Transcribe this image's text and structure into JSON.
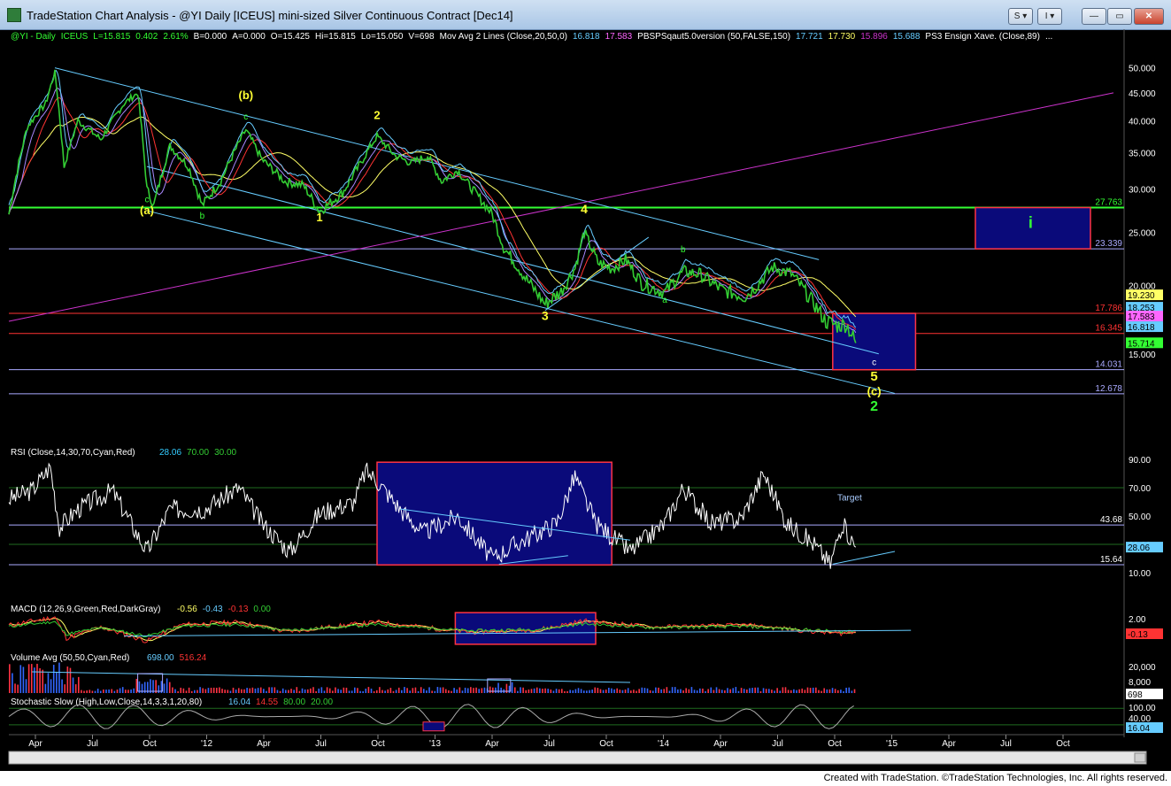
{
  "window": {
    "title": "TradeStation Chart Analysis - @YI Daily [ICEUS] mini-sized Silver Continuous Contract [Dec14]",
    "btn_s": "S ▾",
    "btn_grip": "I ▾",
    "btn_min": "—",
    "btn_max": "▭",
    "btn_close": "✕"
  },
  "footer": {
    "credit": "Created with TradeStation. ©TradeStation Technologies, Inc. All rights reserved."
  },
  "colors": {
    "background": "#000000",
    "price": "#33cc33",
    "rsi": "#ffffff",
    "channel": "#66ccff",
    "magenta": "#cc33cc",
    "box": "#0a0a7a",
    "wave": "#ffff33"
  },
  "chart_data": [
    {
      "type": "line",
      "header": [
        {
          "text": "@YI - Daily",
          "color": "#33ff33"
        },
        {
          "text": "ICEUS",
          "color": "#33ff33"
        },
        {
          "text": "L=15.815",
          "color": "#33ff33"
        },
        {
          "text": "0.402",
          "color": "#33ff33"
        },
        {
          "text": "2.61%",
          "color": "#33ff33"
        },
        {
          "text": "B=0.000",
          "color": "#ffffff"
        },
        {
          "text": "A=0.000",
          "color": "#ffffff"
        },
        {
          "text": "O=15.425",
          "color": "#ffffff"
        },
        {
          "text": "Hi=15.815",
          "color": "#ffffff"
        },
        {
          "text": "Lo=15.050",
          "color": "#ffffff"
        },
        {
          "text": "V=698",
          "color": "#ffffff"
        },
        {
          "text": "Mov Avg 2 Lines (Close,20,50,0)",
          "color": "#ffffff"
        },
        {
          "text": "16.818",
          "color": "#66ccff"
        },
        {
          "text": "17.583",
          "color": "#ff66ff"
        },
        {
          "text": "PBSPSqaut5.0version (50,FALSE,150)",
          "color": "#ffffff"
        },
        {
          "text": "17.721",
          "color": "#66ccff"
        },
        {
          "text": "17.730",
          "color": "#ffff66"
        },
        {
          "text": "15.896",
          "color": "#cc33cc"
        },
        {
          "text": "15.688",
          "color": "#66ccff"
        },
        {
          "text": "PS3 Ensign Xave. (Close,89)",
          "color": "#ffffff"
        },
        {
          "text": "...",
          "color": "#ffffff"
        }
      ],
      "y_ticks": [
        "50.000",
        "45.000",
        "40.000",
        "35.000",
        "30.000",
        "25.000",
        "20.000",
        "15.000"
      ],
      "x_ticks": [
        "Apr",
        "Jul",
        "Oct",
        "'12",
        "Apr",
        "Jul",
        "Oct",
        "'13",
        "Apr",
        "Jul",
        "Oct",
        "'14",
        "Apr",
        "Jul",
        "Oct",
        "'15",
        "Apr",
        "Jul",
        "Oct"
      ],
      "levels": [
        {
          "label": "27.763",
          "value": 27.763,
          "color": "#33ff33"
        },
        {
          "label": "23.339",
          "value": 23.339,
          "color": "#aaaaff"
        },
        {
          "label": "17.786",
          "value": 17.786,
          "color": "#ff3333"
        },
        {
          "label": "16.345",
          "value": 16.345,
          "color": "#ff3333"
        },
        {
          "label": "14.031",
          "value": 14.031,
          "color": "#aaaaff"
        },
        {
          "label": "12.678",
          "value": 12.678,
          "color": "#aaaaff"
        }
      ],
      "last_value_tags": [
        {
          "label": "19.230",
          "value": 19.23,
          "bg": "#ffff66",
          "fg": "#000000"
        },
        {
          "label": "18.253",
          "value": 18.253,
          "bg": "#66ccff",
          "fg": "#000000"
        },
        {
          "label": "17.583",
          "value": 17.583,
          "bg": "#ff66ff",
          "fg": "#000000"
        },
        {
          "label": "16.818",
          "value": 16.818,
          "bg": "#66ccff",
          "fg": "#000000"
        },
        {
          "label": "15.714",
          "value": 15.714,
          "bg": "#33ff33",
          "fg": "#000000"
        }
      ],
      "wave_labels": [
        {
          "text": "(a)",
          "color": "#ffff33",
          "x": 0.06,
          "y": 27.0,
          "size": 13
        },
        {
          "text": "c",
          "color": "#33ff33",
          "x": 0.06,
          "y": 28.4,
          "size": 10
        },
        {
          "text": "b",
          "color": "#33ff33",
          "x": 0.084,
          "y": 26.5,
          "size": 10
        },
        {
          "text": "(b)",
          "color": "#ffff33",
          "x": 0.103,
          "y": 43.8,
          "size": 13
        },
        {
          "text": "c",
          "color": "#33ff33",
          "x": 0.103,
          "y": 40.2,
          "size": 10
        },
        {
          "text": "1",
          "color": "#ffff33",
          "x": 0.135,
          "y": 26.2,
          "size": 13
        },
        {
          "text": "2",
          "color": "#ffff33",
          "x": 0.16,
          "y": 40.3,
          "size": 13
        },
        {
          "text": "3",
          "color": "#ffff33",
          "x": 0.233,
          "y": 17.3,
          "size": 14
        },
        {
          "text": "4",
          "color": "#ffff33",
          "x": 0.25,
          "y": 27.1,
          "size": 14
        },
        {
          "text": "a",
          "color": "#33ff33",
          "x": 0.285,
          "y": 18.6,
          "size": 10
        },
        {
          "text": "b",
          "color": "#33ff33",
          "x": 0.293,
          "y": 23.0,
          "size": 10
        },
        {
          "text": "c",
          "color": "#ffffff",
          "x": 0.376,
          "y": 14.3,
          "size": 10
        },
        {
          "text": "5",
          "color": "#ffff33",
          "x": 0.376,
          "y": 13.4,
          "size": 15
        },
        {
          "text": "(c)",
          "color": "#ffff33",
          "x": 0.376,
          "y": 12.6,
          "size": 13
        },
        {
          "text": "2",
          "color": "#33ff33",
          "x": 0.376,
          "y": 11.8,
          "size": 16
        },
        {
          "text": "i",
          "color": "#33ff33",
          "x": 0.444,
          "y": 25.5,
          "size": 18
        }
      ],
      "boxes": [
        {
          "x0": 0.358,
          "x1": 0.394,
          "y0": 17.786,
          "y1": 14.031
        },
        {
          "x0": 0.42,
          "x1": 0.47,
          "y0": 27.763,
          "y1": 23.339
        }
      ],
      "price_keys": [
        [
          0.0,
          27.0
        ],
        [
          0.008,
          39.0
        ],
        [
          0.016,
          43.0
        ],
        [
          0.02,
          49.0
        ],
        [
          0.024,
          33.0
        ],
        [
          0.03,
          40.0
        ],
        [
          0.04,
          37.0
        ],
        [
          0.05,
          43.0
        ],
        [
          0.056,
          45.0
        ],
        [
          0.06,
          30.0
        ],
        [
          0.063,
          28.0
        ],
        [
          0.07,
          36.0
        ],
        [
          0.078,
          33.0
        ],
        [
          0.084,
          28.0
        ],
        [
          0.092,
          31.0
        ],
        [
          0.103,
          38.5
        ],
        [
          0.11,
          34.0
        ],
        [
          0.12,
          31.0
        ],
        [
          0.128,
          30.5
        ],
        [
          0.135,
          27.3
        ],
        [
          0.145,
          29.5
        ],
        [
          0.152,
          33.0
        ],
        [
          0.16,
          37.5
        ],
        [
          0.168,
          34.5
        ],
        [
          0.175,
          33.5
        ],
        [
          0.182,
          34.5
        ],
        [
          0.188,
          31.0
        ],
        [
          0.195,
          32.5
        ],
        [
          0.2,
          30.5
        ],
        [
          0.21,
          27.0
        ],
        [
          0.215,
          23.5
        ],
        [
          0.225,
          20.5
        ],
        [
          0.233,
          18.5
        ],
        [
          0.24,
          19.5
        ],
        [
          0.246,
          21.5
        ],
        [
          0.25,
          25.0
        ],
        [
          0.256,
          22.0
        ],
        [
          0.262,
          21.5
        ],
        [
          0.268,
          22.3
        ],
        [
          0.275,
          20.2
        ],
        [
          0.285,
          19.4
        ],
        [
          0.293,
          21.2
        ],
        [
          0.3,
          21.0
        ],
        [
          0.31,
          19.6
        ],
        [
          0.32,
          19.1
        ],
        [
          0.325,
          20.0
        ],
        [
          0.332,
          21.6
        ],
        [
          0.34,
          21.0
        ],
        [
          0.348,
          19.0
        ],
        [
          0.355,
          17.2
        ],
        [
          0.36,
          16.9
        ],
        [
          0.364,
          17.0
        ],
        [
          0.368,
          15.7
        ]
      ],
      "channel_lines": [
        {
          "x0": 0.02,
          "y0": 50.0,
          "x1": 0.352,
          "y1": 22.3,
          "color": "#66ccff"
        },
        {
          "x0": 0.06,
          "y0": 33.0,
          "x1": 0.378,
          "y1": 15.0,
          "color": "#66ccff"
        },
        {
          "x0": 0.06,
          "y0": 27.4,
          "x1": 0.385,
          "y1": 12.7,
          "color": "#66ccff"
        },
        {
          "x0": 0.233,
          "y0": 18.0,
          "x1": 0.278,
          "y1": 24.5,
          "color": "#66ccff"
        },
        {
          "x0": 0.0,
          "y0": 17.2,
          "x1": 0.48,
          "y1": 45.0,
          "color": "#cc33cc"
        }
      ]
    },
    {
      "type": "line",
      "name": "RSI (Close,14,30,70,Cyan,Red)",
      "header_values": [
        {
          "text": "28.06",
          "color": "#33ccff"
        },
        {
          "text": "70.00",
          "color": "#33cc33"
        },
        {
          "text": "30.00",
          "color": "#33cc33"
        }
      ],
      "y_ticks": [
        "90.00",
        "70.00",
        "50.00",
        "30.00",
        "10.00"
      ],
      "levels": [
        {
          "label": "43.68",
          "value": 43.68,
          "color": "#aaaaff"
        },
        {
          "label": "15.64",
          "value": 15.64,
          "color": "#aaaaff"
        }
      ],
      "last_value_tags": [
        {
          "label": "28.06",
          "value": 28.06,
          "bg": "#66ccff",
          "fg": "#000000"
        }
      ],
      "annotations": [
        {
          "text": "Target",
          "color": "#aaccff",
          "x": 0.36,
          "y": 61
        }
      ],
      "box": {
        "x0": 0.16,
        "x1": 0.262,
        "y0": 88,
        "y1": 15.5
      },
      "keys": [
        [
          0.0,
          62
        ],
        [
          0.01,
          68
        ],
        [
          0.018,
          85
        ],
        [
          0.022,
          42
        ],
        [
          0.03,
          55
        ],
        [
          0.045,
          68
        ],
        [
          0.06,
          25
        ],
        [
          0.07,
          55
        ],
        [
          0.085,
          55
        ],
        [
          0.1,
          70
        ],
        [
          0.11,
          45
        ],
        [
          0.122,
          25
        ],
        [
          0.135,
          52
        ],
        [
          0.15,
          60
        ],
        [
          0.155,
          82
        ],
        [
          0.16,
          75
        ],
        [
          0.17,
          55
        ],
        [
          0.18,
          38
        ],
        [
          0.195,
          50
        ],
        [
          0.21,
          20
        ],
        [
          0.22,
          30
        ],
        [
          0.238,
          45
        ],
        [
          0.246,
          78
        ],
        [
          0.255,
          45
        ],
        [
          0.27,
          25
        ],
        [
          0.285,
          45
        ],
        [
          0.293,
          70
        ],
        [
          0.305,
          45
        ],
        [
          0.318,
          48
        ],
        [
          0.328,
          80
        ],
        [
          0.338,
          45
        ],
        [
          0.35,
          30
        ],
        [
          0.357,
          16
        ],
        [
          0.362,
          45
        ],
        [
          0.368,
          28
        ]
      ]
    },
    {
      "type": "line",
      "name": "MACD (12,26,9,Green,Red,DarkGray)",
      "header_values": [
        {
          "text": "-0.56",
          "color": "#ffff66"
        },
        {
          "text": "-0.43",
          "color": "#66ccff"
        },
        {
          "text": "-0.13",
          "color": "#ff3333"
        },
        {
          "text": "0.00",
          "color": "#33cc33"
        }
      ],
      "y_ticks": [
        "2.00",
        "-0.13"
      ],
      "last_value_tags": [
        {
          "label": "-0.13",
          "value": -0.13,
          "bg": "#ff3333",
          "fg": "#000000"
        }
      ],
      "box": {
        "x0": 0.194,
        "x1": 0.255,
        "y0": 2.5,
        "y1": -2.5
      },
      "keys": [
        [
          0.0,
          0.5
        ],
        [
          0.02,
          1.8
        ],
        [
          0.025,
          -1.5
        ],
        [
          0.04,
          0.2
        ],
        [
          0.06,
          -2.0
        ],
        [
          0.075,
          0.6
        ],
        [
          0.1,
          1.0
        ],
        [
          0.12,
          -0.5
        ],
        [
          0.16,
          1.0
        ],
        [
          0.2,
          -0.6
        ],
        [
          0.23,
          -0.2
        ],
        [
          0.25,
          1.2
        ],
        [
          0.28,
          0.2
        ],
        [
          0.32,
          0.5
        ],
        [
          0.345,
          -0.3
        ],
        [
          0.36,
          -0.8
        ],
        [
          0.368,
          -0.56
        ]
      ]
    },
    {
      "type": "bar",
      "name": "Volume Avg (50,50,Cyan,Red)",
      "header_values": [
        {
          "text": "698.00",
          "color": "#66ccff"
        },
        {
          "text": "516.24",
          "color": "#ff3333"
        }
      ],
      "y_ticks": [
        "20,000",
        "8,000"
      ],
      "last_value_tags": [
        {
          "label": "698",
          "value": 698,
          "bg": "#ffffff",
          "fg": "#000000"
        }
      ]
    },
    {
      "type": "line",
      "name": "Stochastic Slow (High,Low,Close,14,3,3,1,20,80)",
      "header_values": [
        {
          "text": "16.04",
          "color": "#66ccff"
        },
        {
          "text": "14.55",
          "color": "#ff3333"
        },
        {
          "text": "80.00",
          "color": "#33cc33"
        },
        {
          "text": "20.00",
          "color": "#33cc33"
        }
      ],
      "y_ticks": [
        "100.00",
        "40.00"
      ],
      "last_value_tags": [
        {
          "label": "16.04",
          "value": 16.04,
          "bg": "#66ccff",
          "fg": "#000000"
        }
      ]
    }
  ]
}
